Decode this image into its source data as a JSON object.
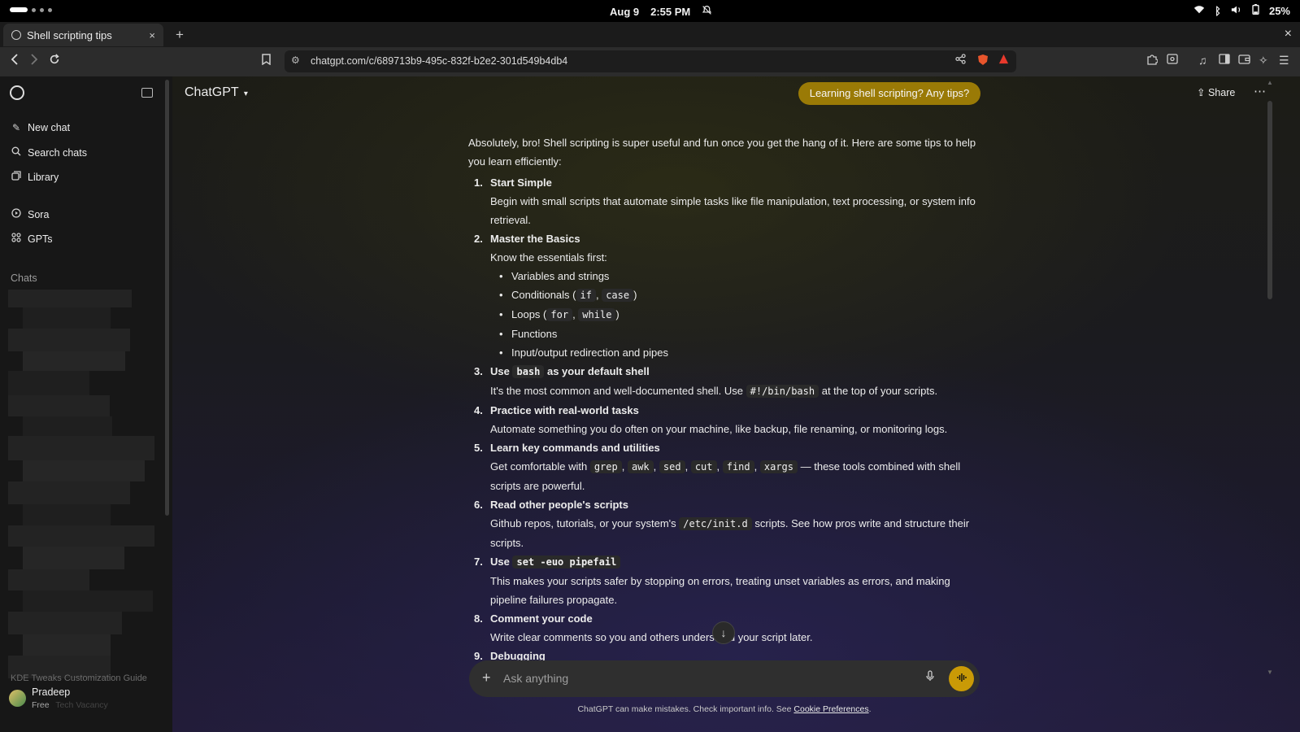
{
  "system": {
    "date": "Aug 9",
    "time": "2:55 PM",
    "battery": "25%"
  },
  "browser": {
    "tab_title": "Shell scripting tips",
    "new_tab": "+",
    "close": "×",
    "url": "chatgpt.com/c/689713b9-495c-832f-b2e2-301d549b4db4"
  },
  "sidebar": {
    "items": [
      {
        "label": "New chat",
        "icon": "pencil-square-icon"
      },
      {
        "label": "Search chats",
        "icon": "search-icon"
      },
      {
        "label": "Library",
        "icon": "library-icon"
      },
      {
        "label": "Sora",
        "icon": "play-circle-icon"
      },
      {
        "label": "GPTs",
        "icon": "grid-icon"
      }
    ],
    "chats_label": "Chats",
    "faded_chat": "KDE Tweaks Customization Guide",
    "user_name": "Pradeep",
    "user_plan": "Free",
    "faded_chat_2": "Tech Vacancy"
  },
  "header": {
    "model": "ChatGPT",
    "user_message": "Learning shell scripting? Any tips?",
    "share": "Share"
  },
  "message": {
    "intro": "Absolutely, bro! Shell scripting is super useful and fun once you get the hang of it. Here are some tips to help you learn efficiently:",
    "s1": {
      "num": "1.",
      "title": "Start Simple",
      "body": "Begin with small scripts that automate simple tasks like file manipulation, text processing, or system info retrieval."
    },
    "s2": {
      "num": "2.",
      "title": "Master the Basics",
      "body": "Know the essentials first:",
      "b1": "Variables and strings",
      "b2a": "Conditionals (",
      "b2c1": "if",
      "b2sep": ", ",
      "b2c2": "case",
      "b2z": ")",
      "b3a": "Loops (",
      "b3c1": "for",
      "b3sep": ", ",
      "b3c2": "while",
      "b3z": ")",
      "b4": "Functions",
      "b5": "Input/output redirection and pipes"
    },
    "s3": {
      "num": "3.",
      "t1": "Use ",
      "code": "bash",
      "t2": " as your default shell",
      "b1": "It's the most common and well-documented shell. Use ",
      "bcode": "#!/bin/bash",
      "b2": " at the top of your scripts."
    },
    "s4": {
      "num": "4.",
      "title": "Practice with real-world tasks",
      "body": "Automate something you do often on your machine, like backup, file renaming, or monitoring logs."
    },
    "s5": {
      "num": "5.",
      "title": "Learn key commands and utilities",
      "b1": "Get comfortable with ",
      "c1": "grep",
      "c2": "awk",
      "c3": "sed",
      "c4": "cut",
      "c5": "find",
      "c6": "xargs",
      "sep": ", ",
      "b2": " — these tools combined with shell scripts are powerful."
    },
    "s6": {
      "num": "6.",
      "title": "Read other people's scripts",
      "b1": "Github repos, tutorials, or your system's ",
      "code": "/etc/init.d",
      "b2": " scripts. See how pros write and structure their scripts."
    },
    "s7": {
      "num": "7.",
      "t1": "Use ",
      "code": "set -euo pipefail",
      "body": "This makes your scripts safer by stopping on errors, treating unset variables as errors, and making pipeline failures propagate."
    },
    "s8": {
      "num": "8.",
      "title": "Comment your code",
      "body": "Write clear comments so you and others understand your script later."
    },
    "s9": {
      "num": "9.",
      "title": "Debugging"
    }
  },
  "composer": {
    "placeholder": "Ask anything",
    "disclaimer": "ChatGPT can make mistakes. Check important info. See ",
    "disclaimer_link": "Cookie Preferences",
    "disclaimer_end": "."
  }
}
